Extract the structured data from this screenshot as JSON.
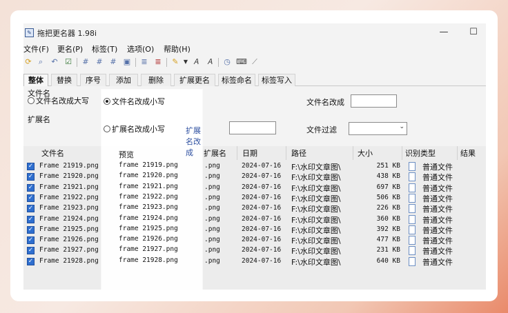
{
  "window": {
    "title": "拖把更名器 1.98i",
    "minimize_glyph": "—",
    "maximize_glyph": "☐"
  },
  "menu": [
    "文件(F)",
    "更名(P)",
    "标签(T)",
    "选项(O)",
    "帮助(H)"
  ],
  "toolbar_icons": [
    "refresh-icon",
    "search-icon",
    "undo-icon",
    "check-icon",
    "number-icon",
    "number-icon",
    "number-icon",
    "image-icon",
    "list-icon",
    "list-icon",
    "pen-icon",
    "dropdown-icon",
    "rename-icon",
    "rename-icon",
    "clock-icon",
    "keyboard-icon",
    "broom-icon"
  ],
  "tabs": [
    "整体",
    "替换",
    "序号",
    "添加",
    "删除",
    "扩展更名",
    "标签命名",
    "标签写入"
  ],
  "active_tab": "整体",
  "filename_group": {
    "label": "文件名",
    "option_upper": "文件名改成大写",
    "option_lower": "文件名改成小写",
    "selected": "lower",
    "change_label": "文件名改成",
    "change_value": ""
  },
  "extension_group": {
    "label": "扩展名",
    "option_lower": "扩展名改成小写",
    "change_label": "扩展名改成",
    "change_value": "",
    "filter_label": "文件过滤",
    "filter_value": ""
  },
  "columns": [
    "文件名",
    "预览",
    "扩展名",
    "日期",
    "路径",
    "大小",
    "识别类型",
    "结果"
  ],
  "rows": [
    {
      "name": "Frame 21919.png",
      "preview": "frame 21919.png",
      "ext": ".png",
      "date": "2024-07-16",
      "path": "F:\\水印文章图\\",
      "size": "251 KB",
      "type": "普通文件",
      "checked": true
    },
    {
      "name": "Frame 21920.png",
      "preview": "frame 21920.png",
      "ext": ".png",
      "date": "2024-07-16",
      "path": "F:\\水印文章图\\",
      "size": "438 KB",
      "type": "普通文件",
      "checked": true
    },
    {
      "name": "Frame 21921.png",
      "preview": "frame 21921.png",
      "ext": ".png",
      "date": "2024-07-16",
      "path": "F:\\水印文章图\\",
      "size": "697 KB",
      "type": "普通文件",
      "checked": true
    },
    {
      "name": "Frame 21922.png",
      "preview": "frame 21922.png",
      "ext": ".png",
      "date": "2024-07-16",
      "path": "F:\\水印文章图\\",
      "size": "506 KB",
      "type": "普通文件",
      "checked": true
    },
    {
      "name": "Frame 21923.png",
      "preview": "frame 21923.png",
      "ext": ".png",
      "date": "2024-07-16",
      "path": "F:\\水印文章图\\",
      "size": "226 KB",
      "type": "普通文件",
      "checked": true
    },
    {
      "name": "Frame 21924.png",
      "preview": "frame 21924.png",
      "ext": ".png",
      "date": "2024-07-16",
      "path": "F:\\水印文章图\\",
      "size": "360 KB",
      "type": "普通文件",
      "checked": true
    },
    {
      "name": "Frame 21925.png",
      "preview": "frame 21925.png",
      "ext": ".png",
      "date": "2024-07-16",
      "path": "F:\\水印文章图\\",
      "size": "392 KB",
      "type": "普通文件",
      "checked": true
    },
    {
      "name": "Frame 21926.png",
      "preview": "frame 21926.png",
      "ext": ".png",
      "date": "2024-07-16",
      "path": "F:\\水印文章图\\",
      "size": "477 KB",
      "type": "普通文件",
      "checked": true
    },
    {
      "name": "Frame 21927.png",
      "preview": "frame 21927.png",
      "ext": ".png",
      "date": "2024-07-16",
      "path": "F:\\水印文章图\\",
      "size": "231 KB",
      "type": "普通文件",
      "checked": true
    },
    {
      "name": "Frame 21928.png",
      "preview": "frame 21928.png",
      "ext": ".png",
      "date": "2024-07-16",
      "path": "F:\\水印文章图\\",
      "size": "640 KB",
      "type": "普通文件",
      "checked": true
    }
  ]
}
